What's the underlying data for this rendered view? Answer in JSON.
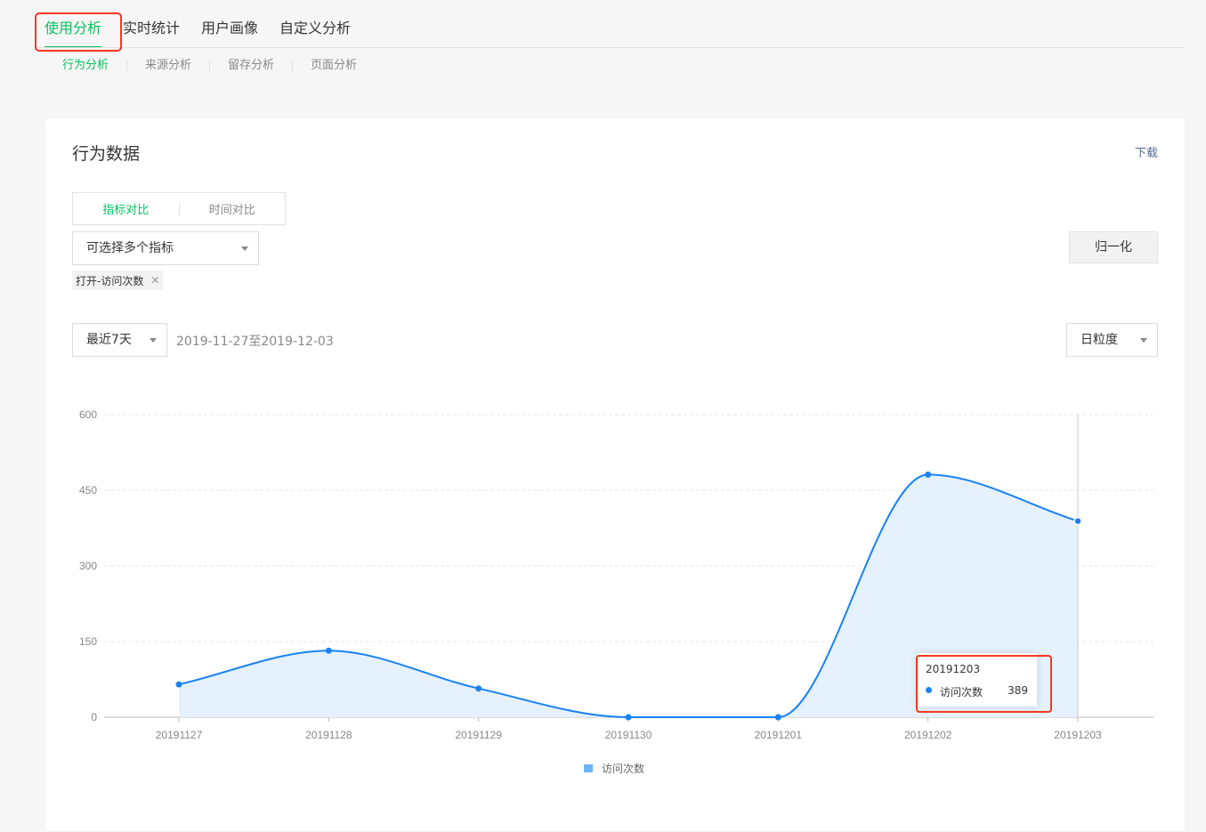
{
  "top_tabs": [
    "使用分析",
    "实时统计",
    "用户画像",
    "自定义分析"
  ],
  "sub_tabs": [
    "行为分析",
    "来源分析",
    "留存分析",
    "页面分析"
  ],
  "card": {
    "title": "行为数据",
    "download": "下载",
    "segment": [
      "指标对比",
      "时间对比"
    ],
    "metric_select": "可选择多个指标",
    "selected_tag": "打开-访问次数",
    "normalize_button": "归一化",
    "period_select": "最近7天",
    "date_range": "2019-11-27至2019-12-03",
    "granularity_select": "日粒度"
  },
  "tooltip": {
    "date": "20191203",
    "label": "访问次数",
    "value": "389"
  },
  "colors": {
    "accent": "#07c160",
    "link": "#576b95",
    "series": "#1a82f5",
    "highlight": "#f5391f"
  },
  "chart_data": {
    "type": "area",
    "categories": [
      "20191127",
      "20191128",
      "20191129",
      "20191130",
      "20191201",
      "20191202",
      "20191203"
    ],
    "series": [
      {
        "name": "访问次数",
        "values": [
          65,
          132,
          57,
          0,
          0,
          481,
          389
        ]
      }
    ],
    "ylim": [
      0,
      600
    ],
    "yticks": [
      0,
      150,
      300,
      450,
      600
    ],
    "grid": true,
    "smooth": true,
    "legend": "bottom-center"
  }
}
